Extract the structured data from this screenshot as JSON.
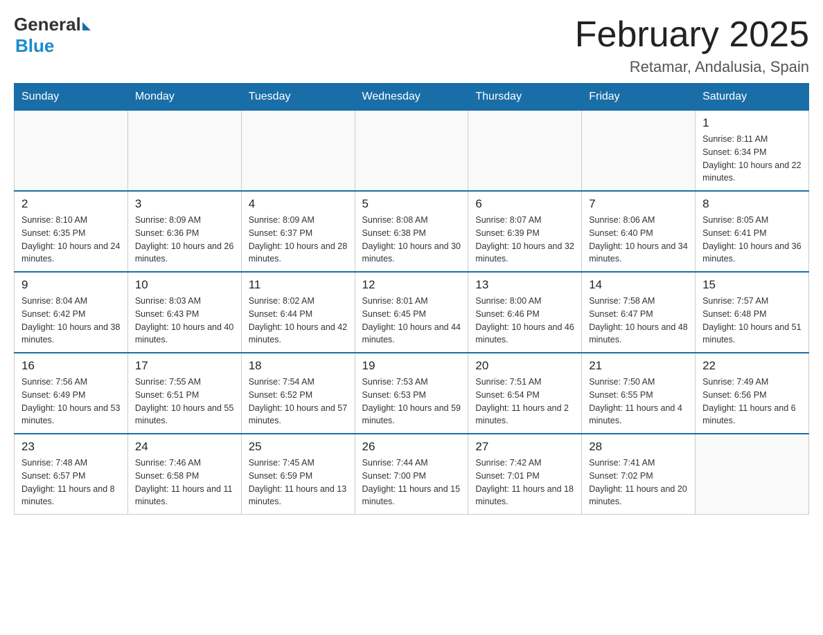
{
  "header": {
    "logo_general": "General",
    "logo_blue": "Blue",
    "month_title": "February 2025",
    "location": "Retamar, Andalusia, Spain"
  },
  "days_of_week": [
    "Sunday",
    "Monday",
    "Tuesday",
    "Wednesday",
    "Thursday",
    "Friday",
    "Saturday"
  ],
  "weeks": [
    [
      {
        "day": "",
        "info": ""
      },
      {
        "day": "",
        "info": ""
      },
      {
        "day": "",
        "info": ""
      },
      {
        "day": "",
        "info": ""
      },
      {
        "day": "",
        "info": ""
      },
      {
        "day": "",
        "info": ""
      },
      {
        "day": "1",
        "info": "Sunrise: 8:11 AM\nSunset: 6:34 PM\nDaylight: 10 hours and 22 minutes."
      }
    ],
    [
      {
        "day": "2",
        "info": "Sunrise: 8:10 AM\nSunset: 6:35 PM\nDaylight: 10 hours and 24 minutes."
      },
      {
        "day": "3",
        "info": "Sunrise: 8:09 AM\nSunset: 6:36 PM\nDaylight: 10 hours and 26 minutes."
      },
      {
        "day": "4",
        "info": "Sunrise: 8:09 AM\nSunset: 6:37 PM\nDaylight: 10 hours and 28 minutes."
      },
      {
        "day": "5",
        "info": "Sunrise: 8:08 AM\nSunset: 6:38 PM\nDaylight: 10 hours and 30 minutes."
      },
      {
        "day": "6",
        "info": "Sunrise: 8:07 AM\nSunset: 6:39 PM\nDaylight: 10 hours and 32 minutes."
      },
      {
        "day": "7",
        "info": "Sunrise: 8:06 AM\nSunset: 6:40 PM\nDaylight: 10 hours and 34 minutes."
      },
      {
        "day": "8",
        "info": "Sunrise: 8:05 AM\nSunset: 6:41 PM\nDaylight: 10 hours and 36 minutes."
      }
    ],
    [
      {
        "day": "9",
        "info": "Sunrise: 8:04 AM\nSunset: 6:42 PM\nDaylight: 10 hours and 38 minutes."
      },
      {
        "day": "10",
        "info": "Sunrise: 8:03 AM\nSunset: 6:43 PM\nDaylight: 10 hours and 40 minutes."
      },
      {
        "day": "11",
        "info": "Sunrise: 8:02 AM\nSunset: 6:44 PM\nDaylight: 10 hours and 42 minutes."
      },
      {
        "day": "12",
        "info": "Sunrise: 8:01 AM\nSunset: 6:45 PM\nDaylight: 10 hours and 44 minutes."
      },
      {
        "day": "13",
        "info": "Sunrise: 8:00 AM\nSunset: 6:46 PM\nDaylight: 10 hours and 46 minutes."
      },
      {
        "day": "14",
        "info": "Sunrise: 7:58 AM\nSunset: 6:47 PM\nDaylight: 10 hours and 48 minutes."
      },
      {
        "day": "15",
        "info": "Sunrise: 7:57 AM\nSunset: 6:48 PM\nDaylight: 10 hours and 51 minutes."
      }
    ],
    [
      {
        "day": "16",
        "info": "Sunrise: 7:56 AM\nSunset: 6:49 PM\nDaylight: 10 hours and 53 minutes."
      },
      {
        "day": "17",
        "info": "Sunrise: 7:55 AM\nSunset: 6:51 PM\nDaylight: 10 hours and 55 minutes."
      },
      {
        "day": "18",
        "info": "Sunrise: 7:54 AM\nSunset: 6:52 PM\nDaylight: 10 hours and 57 minutes."
      },
      {
        "day": "19",
        "info": "Sunrise: 7:53 AM\nSunset: 6:53 PM\nDaylight: 10 hours and 59 minutes."
      },
      {
        "day": "20",
        "info": "Sunrise: 7:51 AM\nSunset: 6:54 PM\nDaylight: 11 hours and 2 minutes."
      },
      {
        "day": "21",
        "info": "Sunrise: 7:50 AM\nSunset: 6:55 PM\nDaylight: 11 hours and 4 minutes."
      },
      {
        "day": "22",
        "info": "Sunrise: 7:49 AM\nSunset: 6:56 PM\nDaylight: 11 hours and 6 minutes."
      }
    ],
    [
      {
        "day": "23",
        "info": "Sunrise: 7:48 AM\nSunset: 6:57 PM\nDaylight: 11 hours and 8 minutes."
      },
      {
        "day": "24",
        "info": "Sunrise: 7:46 AM\nSunset: 6:58 PM\nDaylight: 11 hours and 11 minutes."
      },
      {
        "day": "25",
        "info": "Sunrise: 7:45 AM\nSunset: 6:59 PM\nDaylight: 11 hours and 13 minutes."
      },
      {
        "day": "26",
        "info": "Sunrise: 7:44 AM\nSunset: 7:00 PM\nDaylight: 11 hours and 15 minutes."
      },
      {
        "day": "27",
        "info": "Sunrise: 7:42 AM\nSunset: 7:01 PM\nDaylight: 11 hours and 18 minutes."
      },
      {
        "day": "28",
        "info": "Sunrise: 7:41 AM\nSunset: 7:02 PM\nDaylight: 11 hours and 20 minutes."
      },
      {
        "day": "",
        "info": ""
      }
    ]
  ]
}
